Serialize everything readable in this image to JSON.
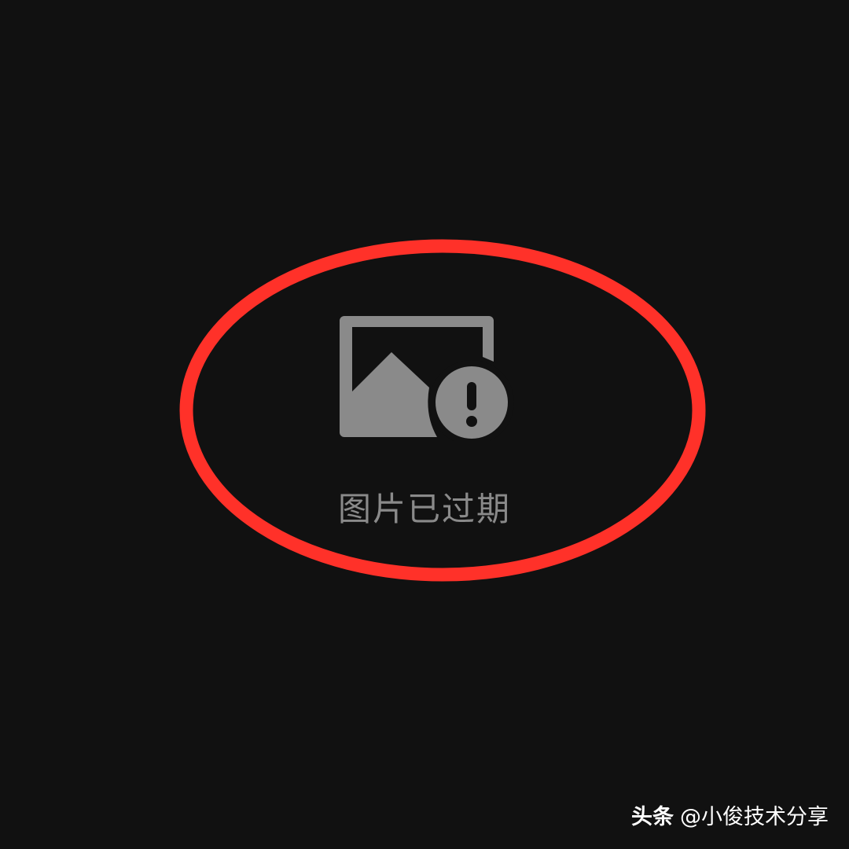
{
  "message": {
    "icon": "image-expired-icon",
    "text": "图片已过期",
    "color": "#8a8a8a"
  },
  "annotation": {
    "shape": "ellipse",
    "color": "#ff3129"
  },
  "watermark": {
    "brand": "头条",
    "author": "@小俊技术分享"
  },
  "background_color": "#111111"
}
